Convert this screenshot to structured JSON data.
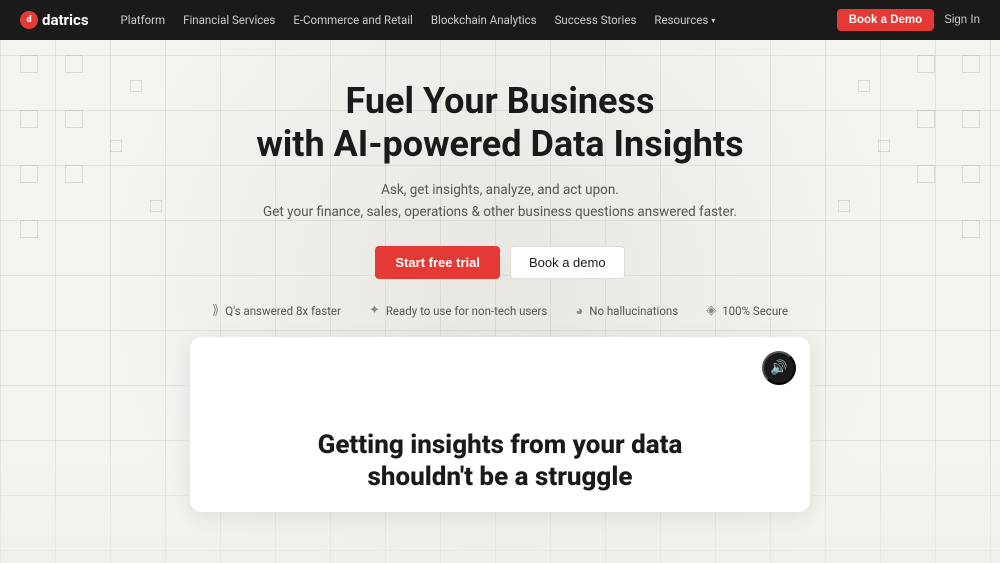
{
  "nav": {
    "logo_text": "datrics",
    "links": [
      {
        "label": "Platform",
        "has_dropdown": false
      },
      {
        "label": "Financial Services",
        "has_dropdown": false
      },
      {
        "label": "E-Commerce and Retail",
        "has_dropdown": false
      },
      {
        "label": "Blockchain Analytics",
        "has_dropdown": false
      },
      {
        "label": "Success Stories",
        "has_dropdown": false
      },
      {
        "label": "Resources",
        "has_dropdown": true
      }
    ],
    "book_demo_label": "Book a Demo",
    "signin_label": "Sign In"
  },
  "hero": {
    "title_line1": "Fuel Your Business",
    "title_line2": "with AI-powered Data Insights",
    "subtitle_line1": "Ask, get insights, analyze, and act upon.",
    "subtitle_line2": "Get your finance, sales, operations & other business questions answered faster.",
    "cta_primary": "Start free trial",
    "cta_secondary": "Book a demo"
  },
  "badges": [
    {
      "icon": "⟫",
      "label": "Q's answered 8x faster"
    },
    {
      "icon": "✦",
      "label": "Ready to use for non-tech users"
    },
    {
      "icon": "◕",
      "label": "No hallucinations"
    },
    {
      "icon": "◈",
      "label": "100% Secure"
    }
  ],
  "video_card": {
    "audio_icon": "🔊",
    "title_line1": "Getting insights from your data",
    "title_line2": "shouldn't be a struggle"
  },
  "colors": {
    "accent": "#e53935",
    "nav_bg": "#1a1a1a",
    "text_dark": "#1a1a1a",
    "text_medium": "#555555"
  }
}
